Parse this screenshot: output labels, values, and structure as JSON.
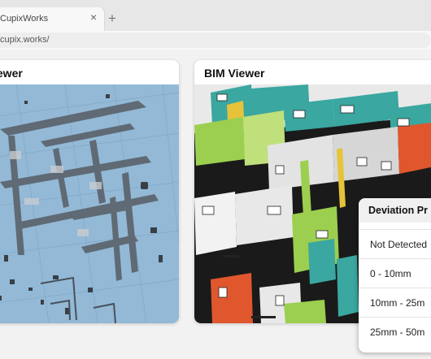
{
  "browser": {
    "tab_title": "CupixWorks",
    "tab_close": "×",
    "new_tab": "+",
    "url": "cupix.works/"
  },
  "scan_viewer": {
    "title": "iewer"
  },
  "bim_viewer": {
    "title": "BIM Viewer"
  },
  "deviation_panel": {
    "title": "Deviation Pr",
    "rows": [
      "Not Detected",
      "0 - 10mm",
      "10mm - 25m",
      "25mm - 50m"
    ]
  },
  "colors": {
    "scan_background": "#93b9d6",
    "bim_accent_teal": "#3aa7a0",
    "bim_accent_yellow": "#e6c33a",
    "bim_accent_green": "#9ccf4f",
    "bim_accent_orange": "#e0572e",
    "bim_floor": "#1a1a1a"
  }
}
